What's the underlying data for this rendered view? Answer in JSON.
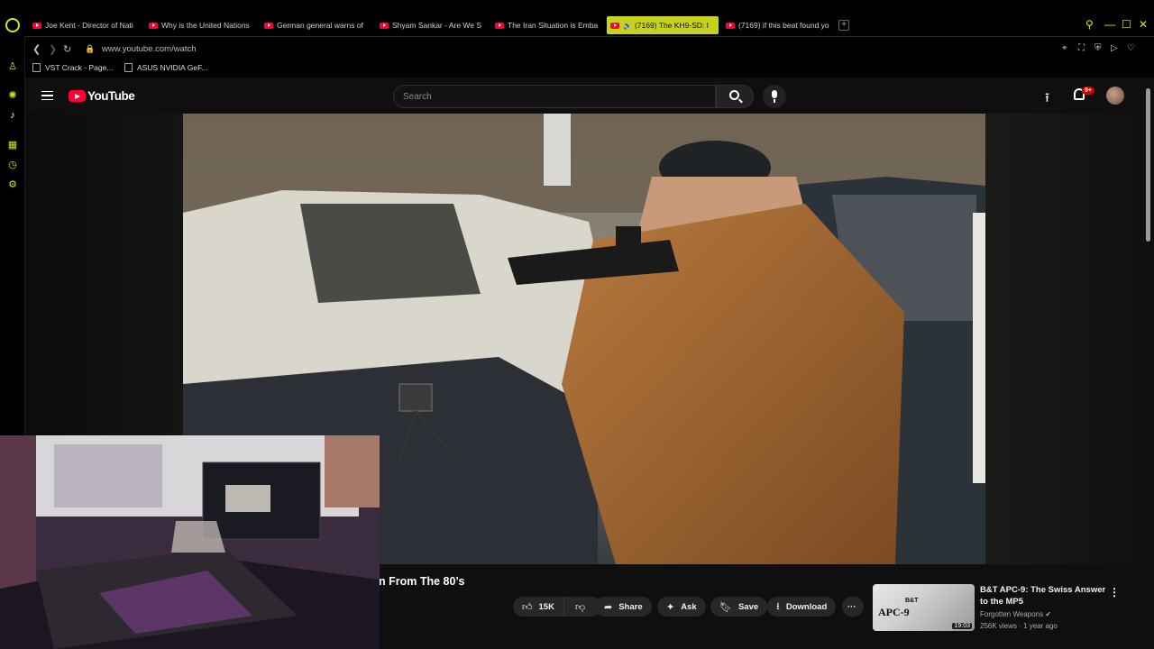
{
  "browser": {
    "tabs": [
      {
        "title": "Joe Kent - Director of Nati"
      },
      {
        "title": "Why is the United Nations"
      },
      {
        "title": "German general warns of"
      },
      {
        "title": "Shyam Sankar - Are We S"
      },
      {
        "title": "The Iran Situation is Emba"
      },
      {
        "title": "(7169) The KH9-SD: I",
        "active": true
      },
      {
        "title": "(7169) if this beat found yo"
      }
    ],
    "url": "www.youtube.com/watch",
    "bookmarks": [
      {
        "label": "VST Crack - Page..."
      },
      {
        "label": "ASUS NVIDIA GeF..."
      }
    ],
    "accent_color": "#c6d21c"
  },
  "youtube": {
    "logo_text": "YouTube",
    "search_placeholder": "Search",
    "notification_badge": "9+",
    "video": {
      "title_visible": "n From The 80’s"
    },
    "actions": {
      "likes": "15K",
      "share": "Share",
      "ask": "Ask",
      "save": "Save",
      "download": "Download"
    },
    "recommendation": {
      "title": "B&T APC-9: The Swiss Answer to the MP5",
      "channel": "Forgotten Weapons",
      "meta": "256K views · 1 year ago",
      "thumb_text_brand": "B&T",
      "thumb_text_model": "APC-9",
      "duration": "19:03"
    }
  }
}
